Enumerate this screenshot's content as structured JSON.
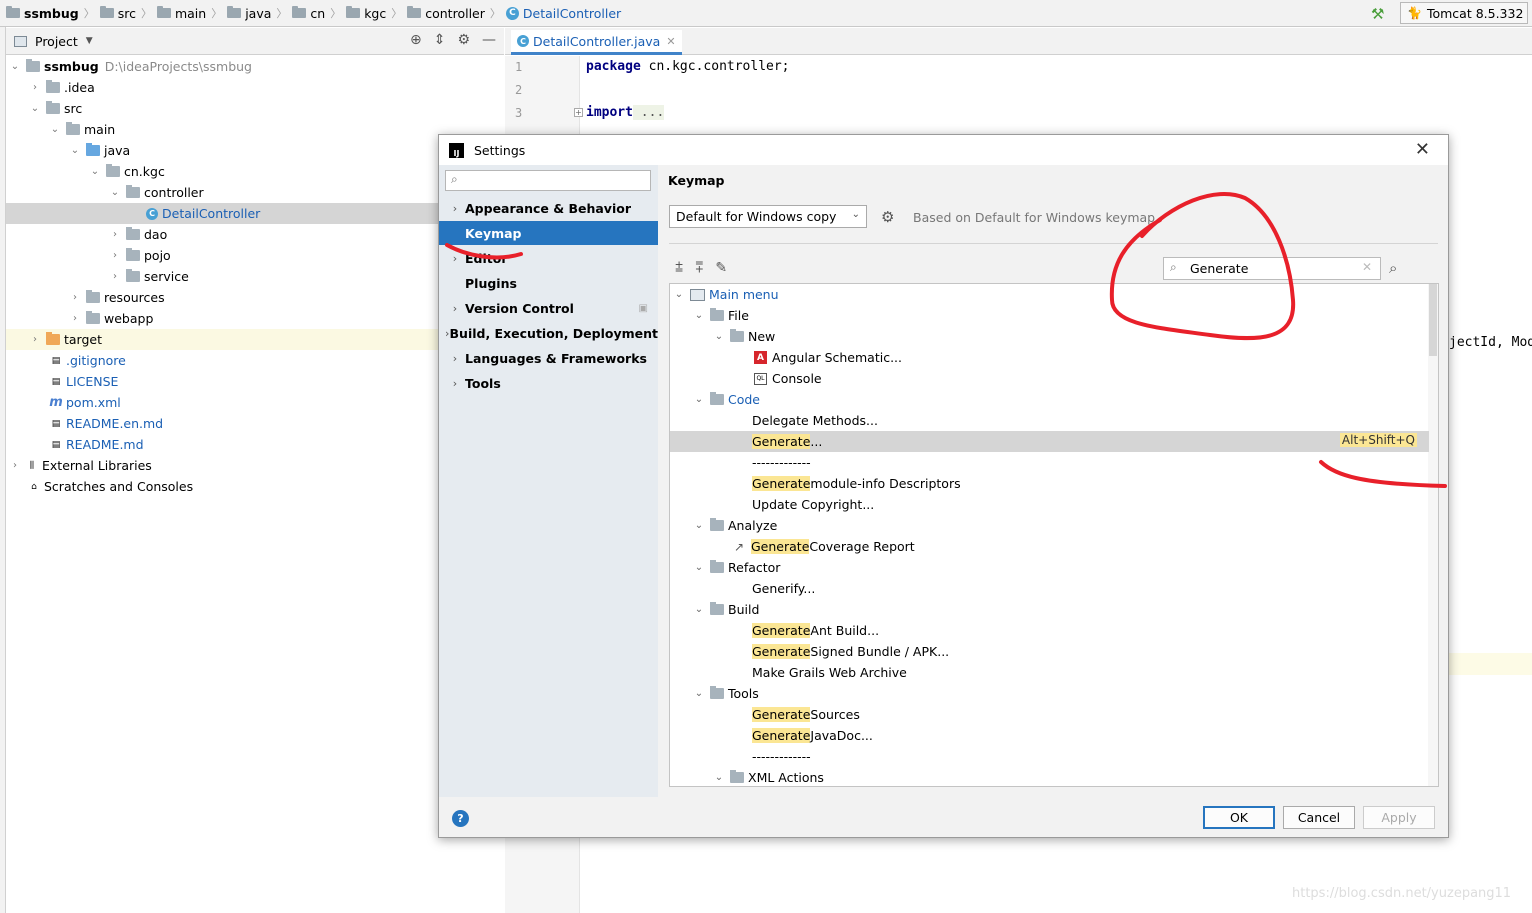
{
  "breadcrumb": [
    "ssmbug",
    "src",
    "main",
    "java",
    "cn",
    "kgc",
    "controller",
    "DetailController"
  ],
  "run_config": "Tomcat 8.5.332",
  "project_panel": {
    "title": "Project",
    "tree": [
      {
        "label": "ssmbug",
        "path": "D:\\ideaProjects\\ssmbug"
      },
      {
        "label": ".idea"
      },
      {
        "label": "src"
      },
      {
        "label": "main"
      },
      {
        "label": "java"
      },
      {
        "label": "cn.kgc"
      },
      {
        "label": "controller"
      },
      {
        "label": "DetailController"
      },
      {
        "label": "dao"
      },
      {
        "label": "pojo"
      },
      {
        "label": "service"
      },
      {
        "label": "resources"
      },
      {
        "label": "webapp"
      },
      {
        "label": "target"
      },
      {
        "label": ".gitignore"
      },
      {
        "label": "LICENSE"
      },
      {
        "label": "pom.xml"
      },
      {
        "label": "README.en.md"
      },
      {
        "label": "README.md"
      },
      {
        "label": "External Libraries"
      },
      {
        "label": "Scratches and Consoles"
      }
    ]
  },
  "editor": {
    "tab": "DetailController.java",
    "line_numbers": [
      "1",
      "2",
      "3"
    ],
    "line1_kw": "package",
    "line1_rest": " cn.kgc.controller;",
    "line3_kw": "import",
    "line3_rest": " ...",
    "peek_text": "jectId, Mod"
  },
  "dialog": {
    "title": "Settings",
    "sidebar": [
      "Appearance & Behavior",
      "Keymap",
      "Editor",
      "Plugins",
      "Version Control",
      "Build, Execution, Deployment",
      "Languages & Frameworks",
      "Tools"
    ],
    "content_title": "Keymap",
    "keymap_value": "Default for Windows copy",
    "keymap_desc": "Based on Default for Windows keymap",
    "search_value": "Generate",
    "tree": {
      "main_menu": "Main menu",
      "file": "File",
      "new": "New",
      "angular": "Angular Schematic...",
      "console": "Console",
      "code": "Code",
      "delegate": "Delegate Methods...",
      "generate_hl": "Generate",
      "generate_tail": "...",
      "shortcut": "Alt+Shift+Q",
      "sep": "-------------",
      "module_info": " module-info Descriptors",
      "update_copyright": "Update Copyright...",
      "analyze": "Analyze",
      "coverage": " Coverage Report",
      "refactor": "Refactor",
      "generify": "Generify...",
      "build": "Build",
      "ant_build": " Ant Build...",
      "signed_bundle": " Signed Bundle / APK...",
      "grails": "Make Grails Web Archive",
      "tools": "Tools",
      "sources": " Sources",
      "javadoc": " JavaDoc...",
      "xml_actions": "XML Actions"
    },
    "ok": "OK",
    "cancel": "Cancel",
    "apply": "Apply"
  },
  "watermark": "https://blog.csdn.net/yuzepang11",
  "colors": {
    "accent": "#2675bf",
    "highlight": "#fbe694",
    "annotation": "#e8202a"
  }
}
